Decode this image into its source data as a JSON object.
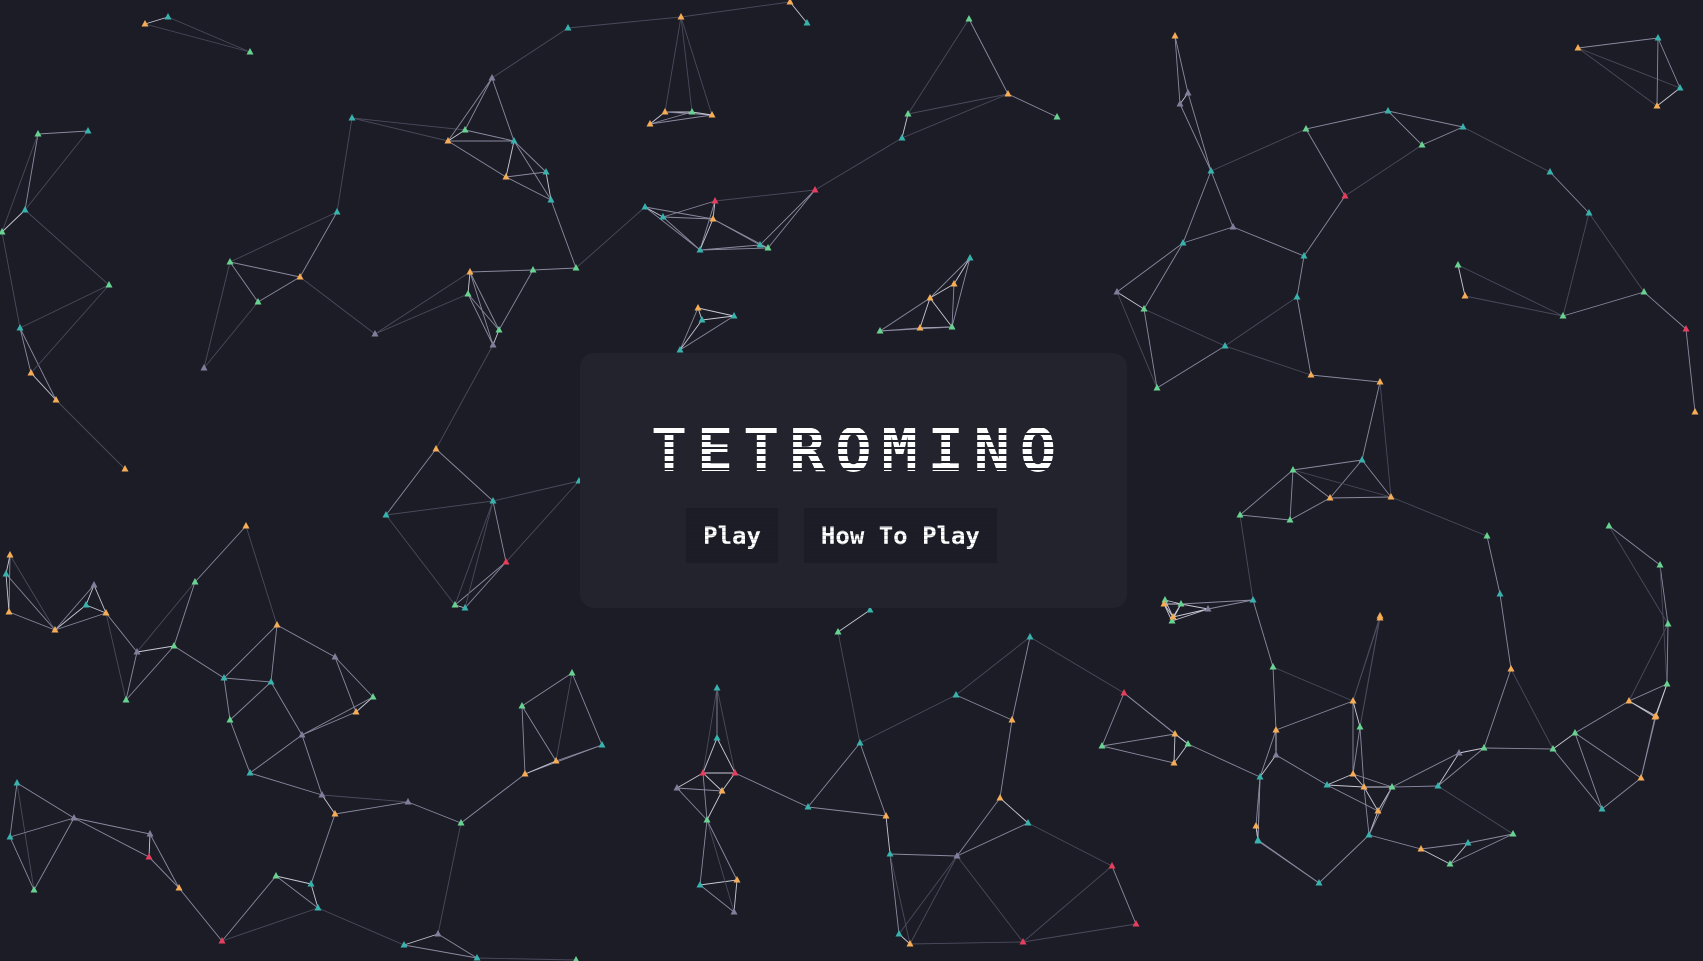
{
  "game": {
    "title": "TETROMINO"
  },
  "menu": {
    "play_label": "Play",
    "how_to_play_label": "How To Play"
  },
  "background": {
    "description_colors": [
      "#f6ad55",
      "#68d391",
      "#38b2ac",
      "#e53e5e",
      "#7f7f9b"
    ],
    "panel_color": "#23232d",
    "page_color": "#1c1c26"
  }
}
